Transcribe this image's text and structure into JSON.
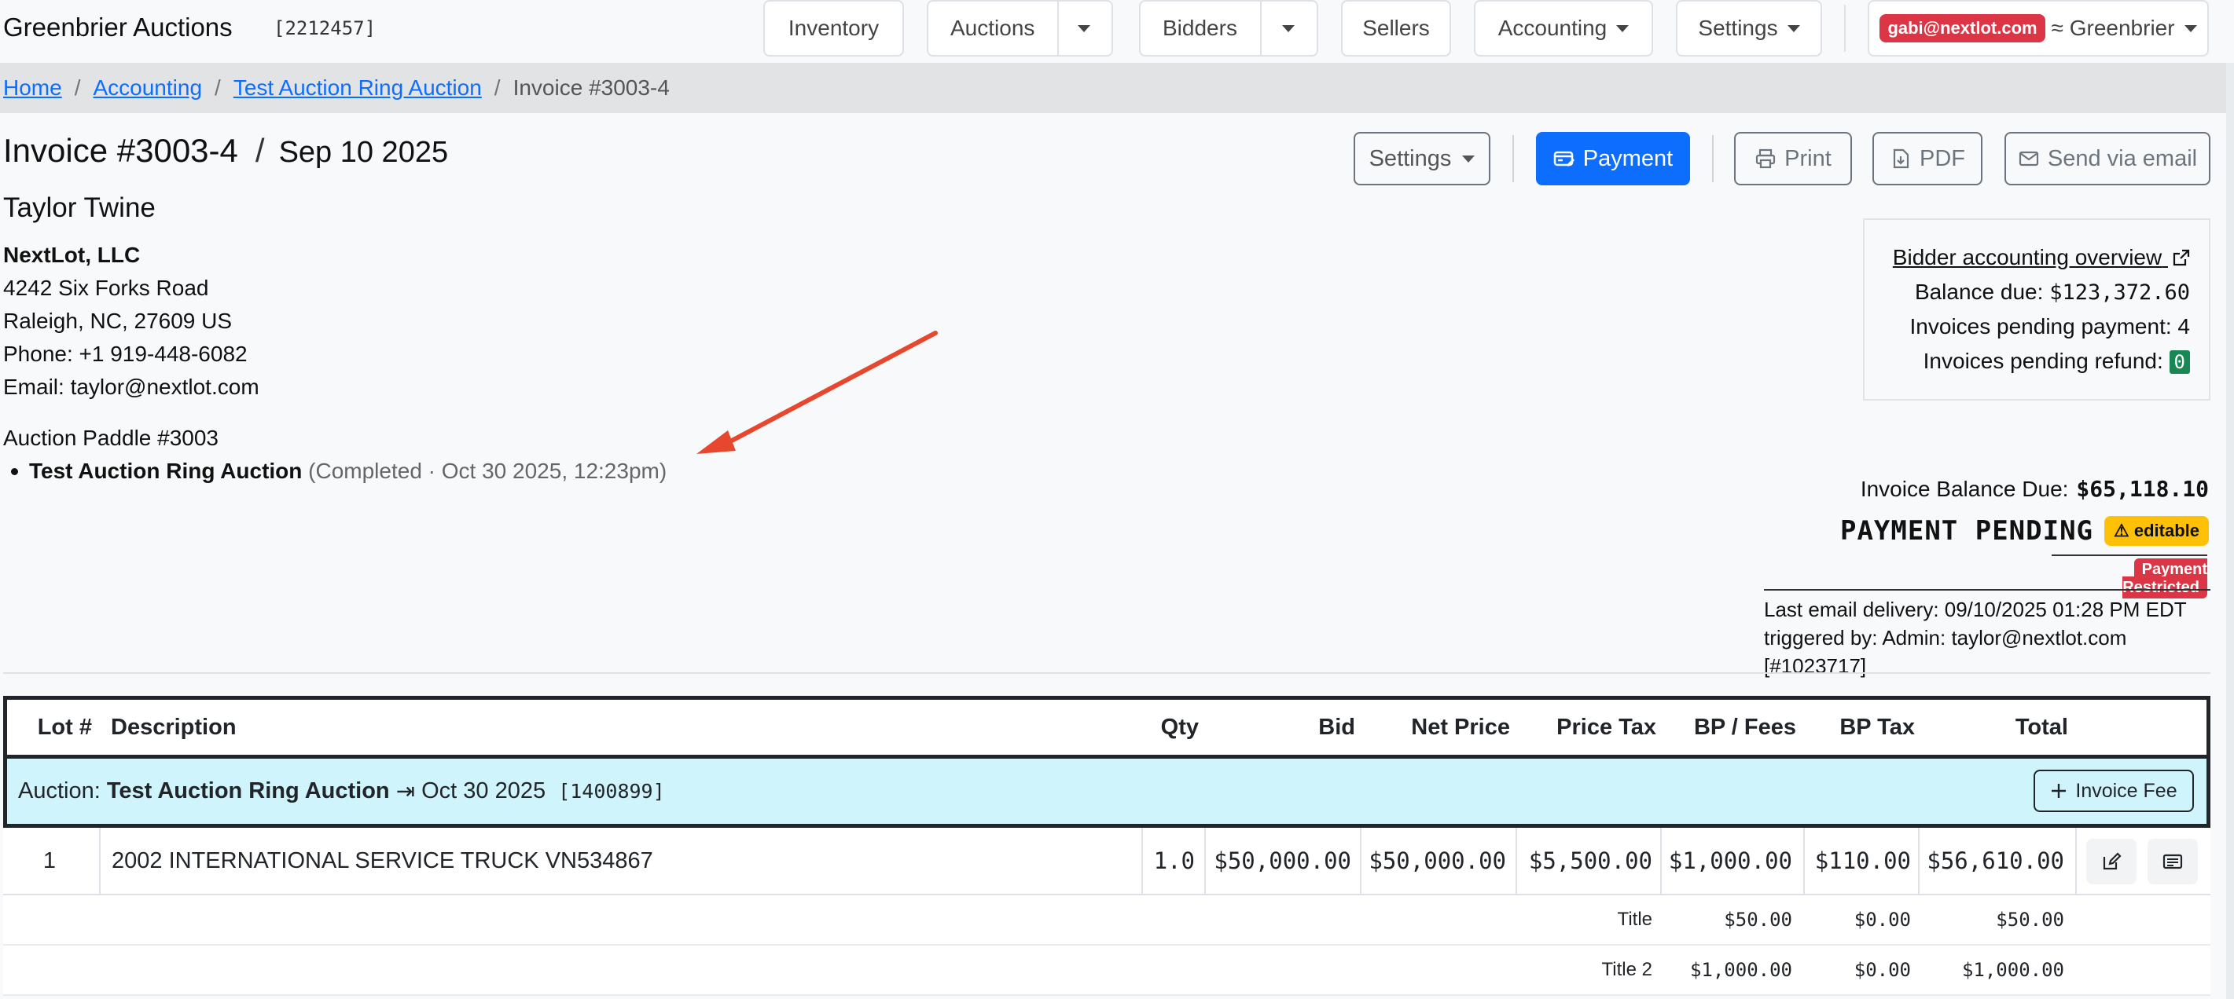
{
  "navbar": {
    "brand": "Greenbrier Auctions",
    "brand_id": "[2212457]",
    "inventory": "Inventory",
    "auctions": "Auctions",
    "bidders": "Bidders",
    "sellers": "Sellers",
    "accounting": "Accounting",
    "settings": "Settings",
    "user_email": "gabi@nextlot.com",
    "org": "≈ Greenbrier"
  },
  "breadcrumb": {
    "home": "Home",
    "accounting": "Accounting",
    "auction": "Test Auction Ring Auction",
    "current": "Invoice #3003-4",
    "sep": "/"
  },
  "header": {
    "invoice": "Invoice #3003-4",
    "slash": "/",
    "date": "Sep 10 2025"
  },
  "actions": {
    "settings": "Settings",
    "payment": "Payment",
    "print": "Print",
    "pdf": "PDF",
    "email": "Send via email"
  },
  "customer": {
    "name": "Taylor Twine",
    "company": "NextLot, LLC",
    "street": "4242 Six Forks Road",
    "city": "Raleigh, NC, 27609 US",
    "phone": "Phone: +1 919-448-6082",
    "email": "Email: taylor@nextlot.com",
    "paddle": "Auction Paddle #3003",
    "auction_name": "Test Auction Ring Auction",
    "auction_status": "(Completed · Oct 30 2025, 12:23pm)"
  },
  "overview": {
    "link": "Bidder accounting overview",
    "balance_label": "Balance due:",
    "balance_value": "$123,372.60",
    "pending_pay_label": "Invoices pending payment:",
    "pending_pay_value": "4",
    "pending_refund_label": "Invoices pending refund:",
    "pending_refund_value": "0"
  },
  "status": {
    "balance_label": "Invoice Balance Due:",
    "balance_value": "$65,118.10",
    "state": "PAYMENT PENDING",
    "editable": "⚠ editable",
    "restricted": "Payment Restricted",
    "email_delivery": "Last email delivery: 09/10/2025 01:28 PM EDT",
    "triggered_by": "triggered by: Admin: taylor@nextlot.com [#1023717]"
  },
  "table": {
    "columns": {
      "lot": "Lot #",
      "description": "Description",
      "qty": "Qty",
      "bid": "Bid",
      "net": "Net Price",
      "tax": "Price Tax",
      "bp": "BP / Fees",
      "bptax": "BP Tax",
      "total": "Total"
    },
    "auction_row": {
      "prefix": "Auction:",
      "name": "Test Auction Ring Auction",
      "arrow": "⇥",
      "date": "Oct 30 2025",
      "id": "[1400899]",
      "fee_button": "Invoice Fee"
    },
    "item": {
      "lot": "1",
      "description": "2002 INTERNATIONAL SERVICE TRUCK VN534867",
      "qty": "1.0",
      "bid": "$50,000.00",
      "net": "$50,000.00",
      "tax": "$5,500.00",
      "bp": "$1,000.00",
      "bptax": "$110.00",
      "total": "$56,610.00"
    },
    "fees": [
      {
        "label": "Title",
        "bp": "$50.00",
        "bptax": "$0.00",
        "total": "$50.00"
      },
      {
        "label": "Title 2",
        "bp": "$1,000.00",
        "bptax": "$0.00",
        "total": "$1,000.00"
      }
    ]
  },
  "colors": {
    "primary": "#0d6efd",
    "danger": "#dc3545",
    "warning": "#ffc107",
    "success": "#198754",
    "info_row": "#cff4fc",
    "annotation_arrow": "#e8472f"
  }
}
